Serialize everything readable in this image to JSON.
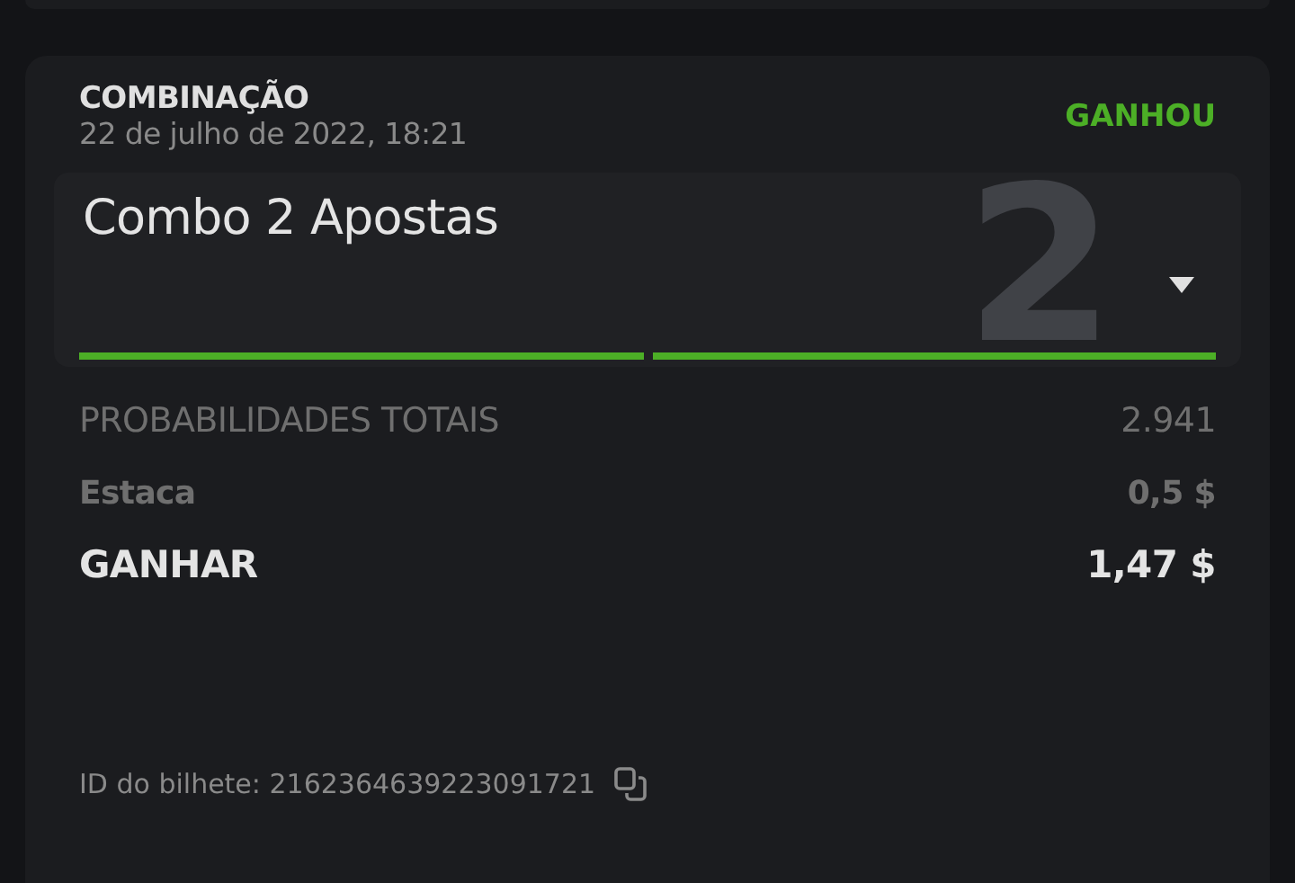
{
  "bet": {
    "type": "COMBINAÇÃO",
    "date": "22 de julho de 2022, 18:21",
    "status": "GANHOU",
    "won": true,
    "combo": {
      "title": "Combo 2 Apostas",
      "count": "2",
      "expanded": false,
      "legs": [
        {
          "won": true
        },
        {
          "won": true
        }
      ]
    },
    "rows": [
      {
        "kind": "muted",
        "label": "PROBABILIDADES TOTAIS",
        "value": "2.941"
      },
      {
        "kind": "bold-muted",
        "label": "Estaca",
        "value": "0,5 $"
      },
      {
        "kind": "bold",
        "label": "GANHAR",
        "value": "1,47 $"
      }
    ],
    "ticket_id": "ID do bilhete: 2162364639223091721"
  }
}
